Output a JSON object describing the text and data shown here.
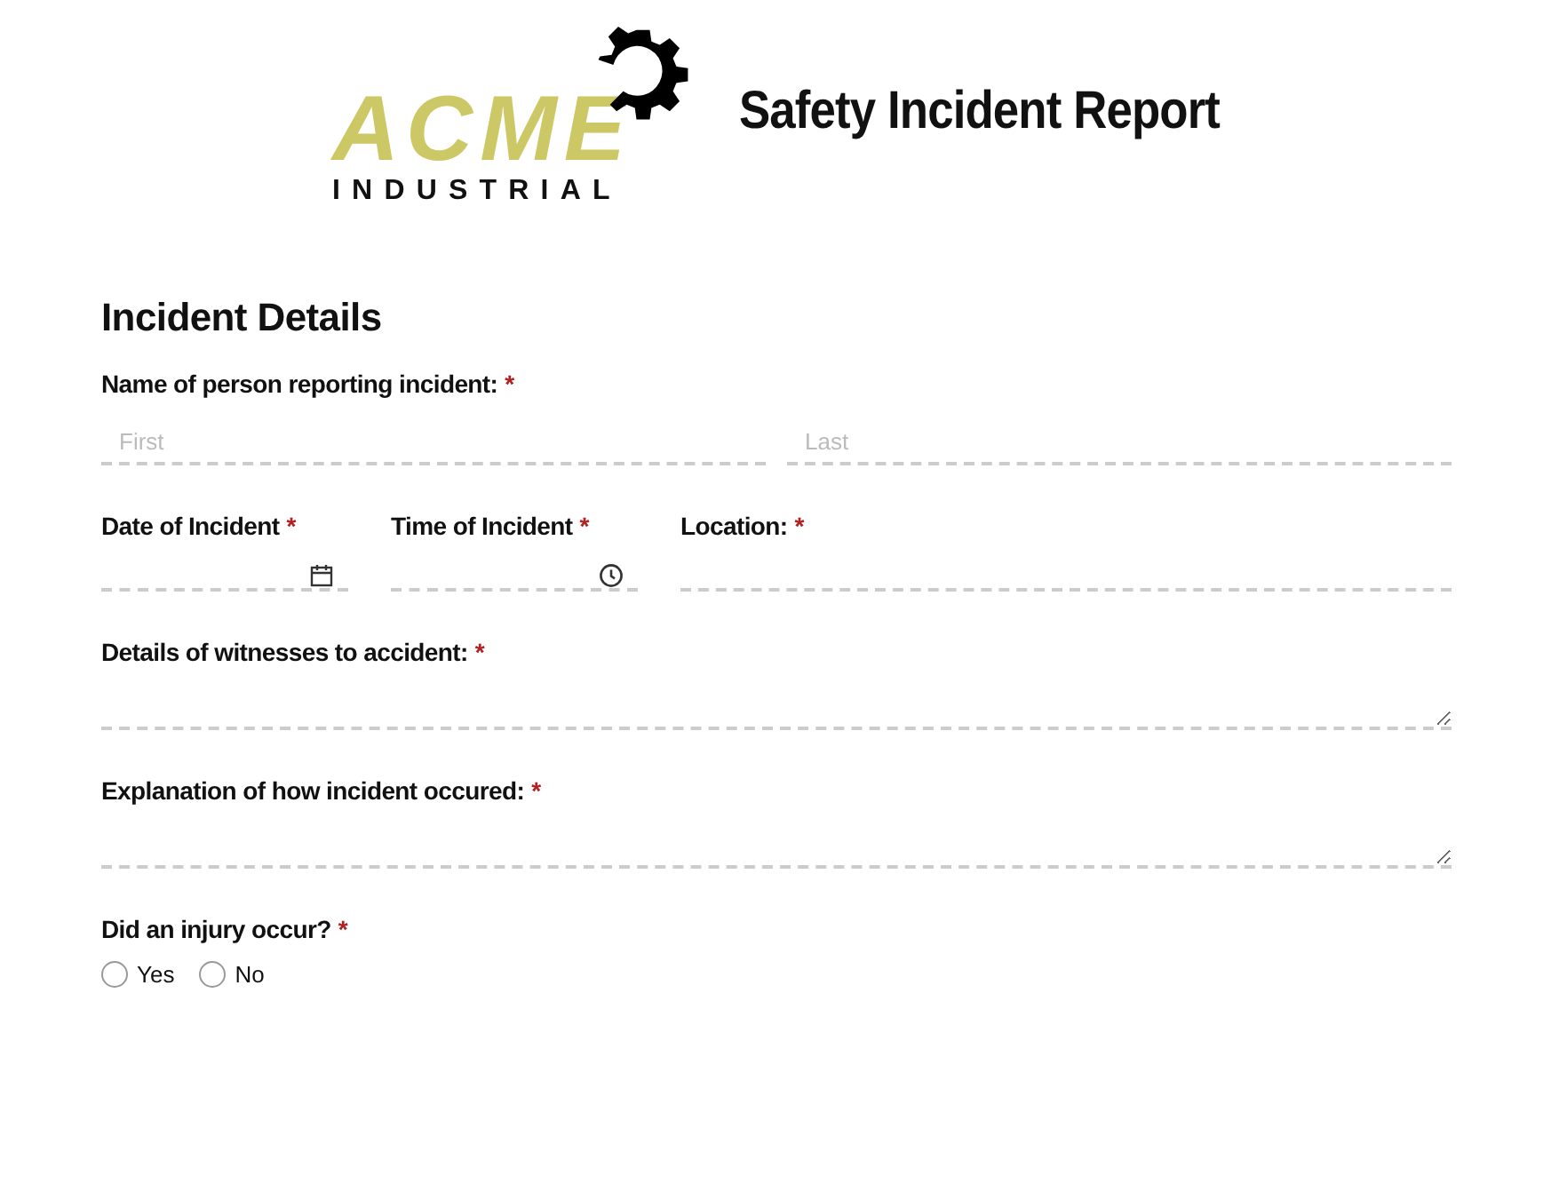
{
  "logo": {
    "brand": "ACME",
    "subtitle": "INDUSTRIAL"
  },
  "title": "Safety Incident Report",
  "section": "Incident Details",
  "rows": [
    {
      "fields": [
        {
          "kind": "name",
          "label": "Name of person reporting incident:",
          "required": true,
          "mark": "*",
          "parts": [
            {
              "placeholder": "First"
            },
            {
              "placeholder": "Last"
            }
          ]
        }
      ]
    },
    {
      "fields": [
        {
          "kind": "date",
          "label": "Date of Incident",
          "required": true,
          "mark": "*"
        },
        {
          "kind": "time",
          "label": "Time of Incident",
          "required": true,
          "mark": "*"
        },
        {
          "kind": "text",
          "label": "Location:",
          "required": true,
          "mark": "*"
        }
      ]
    },
    {
      "fields": [
        {
          "kind": "textarea",
          "label": "Details of witnesses to accident:",
          "required": true,
          "mark": "*"
        }
      ]
    },
    {
      "fields": [
        {
          "kind": "textarea",
          "label": "Explanation of how incident occured:",
          "required": true,
          "mark": "*"
        }
      ]
    },
    {
      "fields": [
        {
          "kind": "radio",
          "label": "Did an injury occur?",
          "required": true,
          "mark": "*",
          "options": [
            {
              "label": "Yes",
              "selected": false
            },
            {
              "label": "No",
              "selected": false
            }
          ]
        }
      ]
    }
  ]
}
